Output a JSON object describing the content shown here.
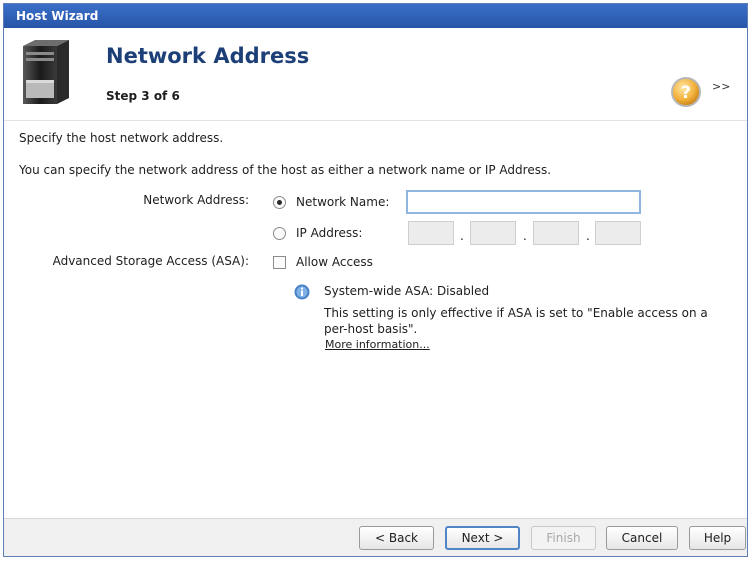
{
  "window": {
    "title": "Host Wizard"
  },
  "header": {
    "title": "Network Address",
    "step": "Step 3 of 6",
    "help_icon": "question-circle-icon",
    "expand_label": ">>"
  },
  "content": {
    "intro": "Specify the host network address.",
    "description": "You can specify the network address of the host as either a network name or IP Address.",
    "network_address_label": "Network Address:",
    "network_name_option": {
      "label": "Network Name:",
      "selected": true,
      "value": ""
    },
    "ip_address_option": {
      "label": "IP Address:",
      "selected": false,
      "octets": [
        "",
        "",
        "",
        ""
      ]
    },
    "ip_separator": ".",
    "asa_label": "Advanced Storage Access (ASA):",
    "allow_access": {
      "label": "Allow Access",
      "checked": false
    },
    "info": {
      "icon": "info-icon",
      "title": "System-wide ASA: Disabled",
      "text": "This setting is only effective if ASA is set to \"Enable access on a per-host basis\".",
      "link": "More information..."
    }
  },
  "footer": {
    "back": "< Back",
    "next": "Next >",
    "finish": "Finish",
    "cancel": "Cancel",
    "help": "Help"
  },
  "colors": {
    "titlebar": "#2f62b9",
    "heading": "#1c3f78",
    "focus_border": "#8fb6e0"
  }
}
